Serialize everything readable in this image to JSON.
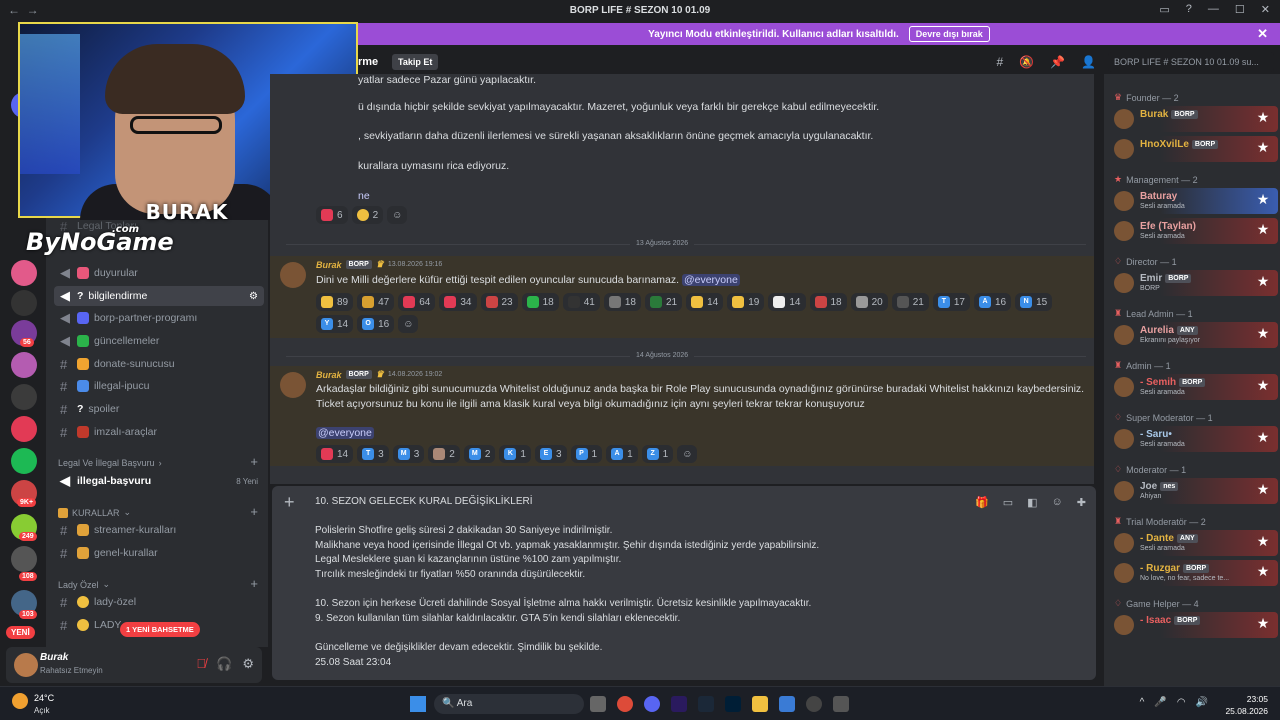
{
  "window": {
    "title": "BORP LIFE # SEZON 10 01.09"
  },
  "banner": {
    "text": "Yayıncı Modu etkinleştirildi. Kullanıcı adları kısaltıldı.",
    "button": "Devre dışı bırak"
  },
  "header": {
    "channel_fragment": "rme",
    "follow": "Takip Et",
    "search_placeholder": "BORP LIFE # SEZON 10 01.09 su..."
  },
  "stream": {
    "caster": "BURAK",
    "sponsor": "ByNoGame",
    "sponsor_suffix": ".com"
  },
  "servers": {
    "badges": [
      "56",
      "9K+",
      "249",
      "108",
      "103"
    ],
    "new_label": "YENİ"
  },
  "channels": {
    "hidden_top": "Legal Topları",
    "items": [
      {
        "label": "duyurular"
      },
      {
        "label": "bilgilendirme"
      },
      {
        "label": "borp-partner-programı"
      },
      {
        "label": "güncellemeler"
      },
      {
        "label": "donate-sunucusu"
      },
      {
        "label": "illegal-ipucu"
      },
      {
        "label": "spoiler"
      },
      {
        "label": "imzalı-araçlar"
      }
    ],
    "cat_legal": "Legal Ve İllegal Başvuru",
    "illegal_basvuru": "illegal-başvuru",
    "illegal_new": "8 Yeni",
    "cat_kurallar": "KURALLAR",
    "kurallar_items": [
      "streamer-kuralları",
      "genel-kurallar"
    ],
    "cat_lady": "Lady Özel",
    "lady_items": [
      "lady-özel",
      "LADY"
    ],
    "mention_pill": "1 YENİ BAHSETME"
  },
  "user": {
    "name": "Burak",
    "status": "Rahatsız Etmeyin"
  },
  "chat": {
    "partial_lines": [
      "yatlar sadece Pazar günü yapılacaktır.",
      "ü dışında hiçbir şekilde sevkiyat yapılmayacaktır. Mazeret, yoğunluk veya farklı bir gerekçe kabul edilmeyecektir.",
      ", sevkiyatların daha düzenli ilerlemesi ve sürekli yaşanan aksaklıkların önüne geçmek amacıyla uygulanacaktır.",
      "kurallara uymasını rica ediyoruz.",
      "ne"
    ],
    "top_reacts": [
      "6",
      "2"
    ],
    "date1": "13 Ağustos 2026",
    "msg1": {
      "author": "Burak",
      "tag": "BORP",
      "time": "13.08.2026 19:16",
      "text": "Dini ve Milli değerlere küfür ettiği tespit edilen oyuncular sunucuda barınamaz.",
      "mention": "@everyone",
      "reactions": [
        "89",
        "47",
        "64",
        "34",
        "23",
        "18",
        "41",
        "18",
        "21",
        "14",
        "19",
        "14",
        "18",
        "20",
        "21",
        "17",
        "16",
        "15",
        "14",
        "16"
      ]
    },
    "date2": "14 Ağustos 2026",
    "msg2": {
      "author": "Burak",
      "tag": "BORP",
      "time": "14.08.2026 19:02",
      "line1": "Arkadaşlar bildiğiniz gibi sunucumuzda Whitelist olduğunuz anda başka bir Role Play sunucusunda oynadığınız görünürse buradaki Whitelist hakkınızı kaybedersiniz.",
      "line2": "Ticket açıyorsunuz bu konu ile ilgili ama klasik kural veya bilgi okumadığınız için aynı şeyleri tekrar tekrar konuşuyoruz",
      "mention": "@everyone",
      "reactions": [
        "14",
        "3",
        "3",
        "2",
        "2",
        "1",
        "3",
        "1",
        "1",
        "1"
      ]
    }
  },
  "composer": {
    "lines": [
      "10. SEZON GELECEK KURAL DEĞİŞİKLİKLERİ",
      "",
      "Polislerin Shotfire geliş süresi 2 dakikadan 30 Saniyeye indirilmiştir.",
      "Malikhane veya hood içerisinde İllegal Ot vb. yapmak yasaklanmıştır. Şehir dışında istediğiniz yerde yapabilirsiniz.",
      "Legal Mesleklere şuan ki kazançlarının üstüne %100 zam yapılmıştır.",
      "Tırcılık mesleğindeki tır fiyatları %50 oranında düşürülecektir.",
      "",
      "10. Sezon için herkese Ücreti dahilinde Sosyal İşletme alma hakkı verilmiştir. Ücretsiz kesinlikle yapılmayacaktır.",
      "9. Sezon kullanılan tüm silahlar kaldırılacaktır. GTA 5'in kendi silahları eklenecektir.",
      "",
      "Güncelleme ve değişiklikler devam edecektir. Şimdilik bu şekilde.",
      "25.08 Saat 23:04"
    ]
  },
  "members": {
    "roles": [
      {
        "title": "Founder — 2",
        "members": [
          {
            "name": "Burak",
            "tag": "BORP",
            "sub": ""
          },
          {
            "name": "HnoXvilLe",
            "tag": "BORP",
            "sub": ""
          }
        ]
      },
      {
        "title": "Management — 2",
        "members": [
          {
            "name": "Baturay",
            "tag": "",
            "sub": "Sesli aramada"
          },
          {
            "name": "Efe (Taylan)",
            "tag": "",
            "sub": "Sesli aramada"
          }
        ]
      },
      {
        "title": "Director — 1",
        "members": [
          {
            "name": "Emir",
            "tag": "BORP",
            "sub": "BORP"
          }
        ]
      },
      {
        "title": "Lead Admin — 1",
        "members": [
          {
            "name": "Aurelia",
            "tag": "ANY",
            "sub": "Ekranını paylaşıyor"
          }
        ]
      },
      {
        "title": "Admin — 1",
        "members": [
          {
            "name": "- Semih",
            "tag": "BORP",
            "sub": "Sesli aramada"
          }
        ]
      },
      {
        "title": "Super Moderator — 1",
        "members": [
          {
            "name": "- Saru•",
            "tag": "",
            "sub": "Sesli aramada"
          }
        ]
      },
      {
        "title": "Moderator — 1",
        "members": [
          {
            "name": "Joe",
            "tag": "nes",
            "sub": "Ahiyan"
          }
        ]
      },
      {
        "title": "Trial Moderatör — 2",
        "members": [
          {
            "name": "- Dante",
            "tag": "ANY",
            "sub": "Sesli aramada"
          },
          {
            "name": "- Ruzgar",
            "tag": "BORP",
            "sub": "No love, no fear, sadece te..."
          }
        ]
      },
      {
        "title": "Game Helper — 4",
        "members": [
          {
            "name": "- Isaac",
            "tag": "BORP",
            "sub": ""
          }
        ]
      }
    ]
  },
  "taskbar": {
    "temp": "24°C",
    "weather": "Açık",
    "search": "Ara",
    "time": "23:05",
    "date": "25.08.2026"
  }
}
